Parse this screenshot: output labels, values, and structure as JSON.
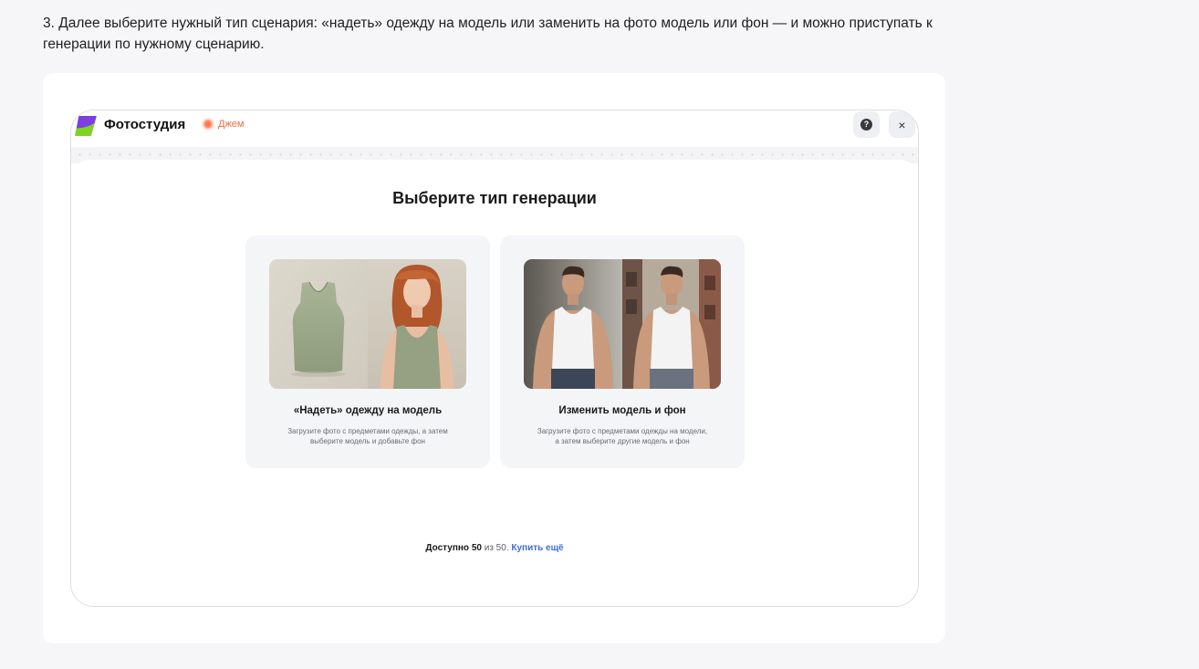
{
  "article": {
    "text": "3. Далее выберите нужный тип сценария: «надеть» одежду на модель или заменить на фото модель или фон — и можно приступать к генерации по нужному сценарию."
  },
  "app": {
    "title": "Фотостудия",
    "badge_label": "Джем",
    "help_glyph": "?",
    "close_glyph": "×"
  },
  "main": {
    "title": "Выберите тип генерации",
    "cards": [
      {
        "title": "«Надеть» одежду на модель",
        "desc_line1": "Загрузите фото с предметами одежды, а затем",
        "desc_line2": "выберите модель и добавьте фон"
      },
      {
        "title": "Изменить модель и фон",
        "desc_line1": "Загрузите фото с предметами одежды на модели,",
        "desc_line2": "а затем выберите другие модель и фон"
      }
    ]
  },
  "quota": {
    "prefix": "Доступно",
    "available": "50",
    "middle": "из 50.",
    "buy_label": "Купить ещё"
  },
  "colors": {
    "accent_link": "#3f6fd8",
    "badge": "#ee6b43",
    "logo_purple": "#7b3fe4",
    "logo_green": "#7ed321"
  }
}
